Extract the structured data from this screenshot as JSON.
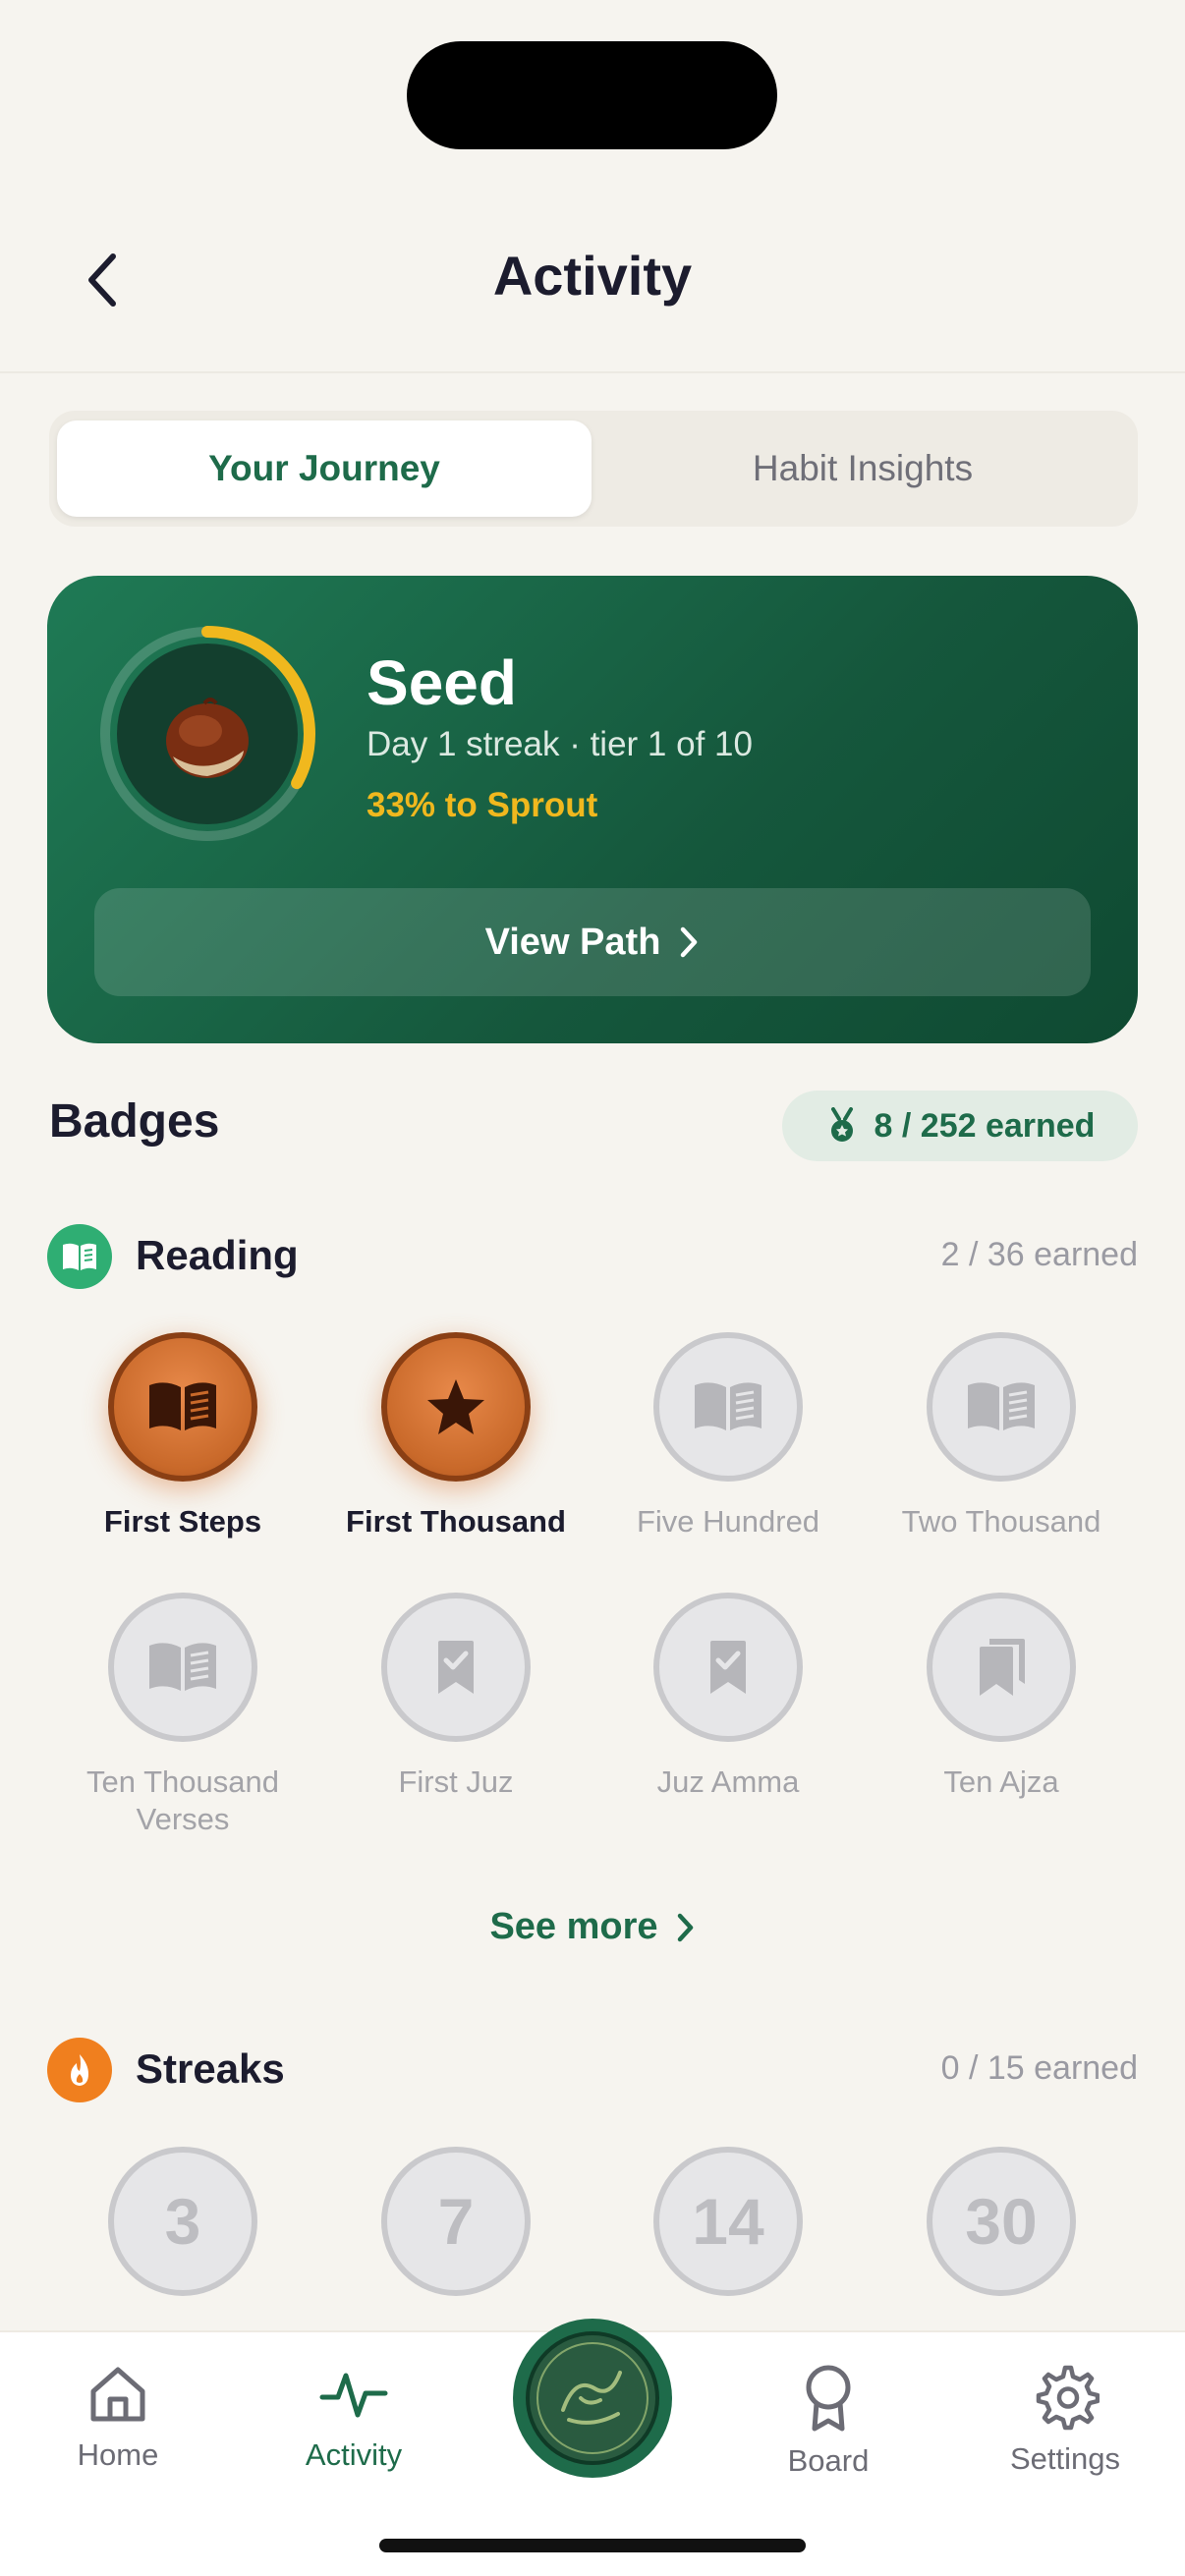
{
  "header": {
    "title": "Activity"
  },
  "segment": {
    "active": "Your Journey",
    "inactive": "Habit Insights"
  },
  "hero": {
    "tier_name": "Seed",
    "streak_text": "Day 1 streak · tier 1 of 10",
    "progress_text": "33% to Sprout",
    "progress_fraction": 0.33,
    "view_path_label": "View Path",
    "colors": {
      "progress": "#f0b81e",
      "card": "#1a6b4a"
    }
  },
  "badges": {
    "title": "Badges",
    "earned_total": "8 / 252 earned"
  },
  "reading": {
    "name": "Reading",
    "count": "2 / 36 earned",
    "items": [
      {
        "label": "First Steps",
        "icon": "book-icon",
        "earned": true
      },
      {
        "label": "First Thousand",
        "icon": "star-icon",
        "earned": true
      },
      {
        "label": "Five Hundred",
        "icon": "book-icon",
        "earned": false
      },
      {
        "label": "Two Thousand",
        "icon": "book-icon",
        "earned": false
      },
      {
        "label": "Ten Thousand Verses",
        "icon": "book-icon",
        "earned": false
      },
      {
        "label": "First Juz",
        "icon": "bookmark-check-icon",
        "earned": false
      },
      {
        "label": "Juz Amma",
        "icon": "bookmark-check-icon",
        "earned": false
      },
      {
        "label": "Ten Ajza",
        "icon": "bookmarks-icon",
        "earned": false
      }
    ]
  },
  "see_more": "See more",
  "streaks": {
    "name": "Streaks",
    "count": "0 / 15 earned",
    "items": [
      "3",
      "7",
      "14",
      "30"
    ]
  },
  "tabbar": {
    "home": "Home",
    "activity": "Activity",
    "board": "Board",
    "settings": "Settings"
  }
}
